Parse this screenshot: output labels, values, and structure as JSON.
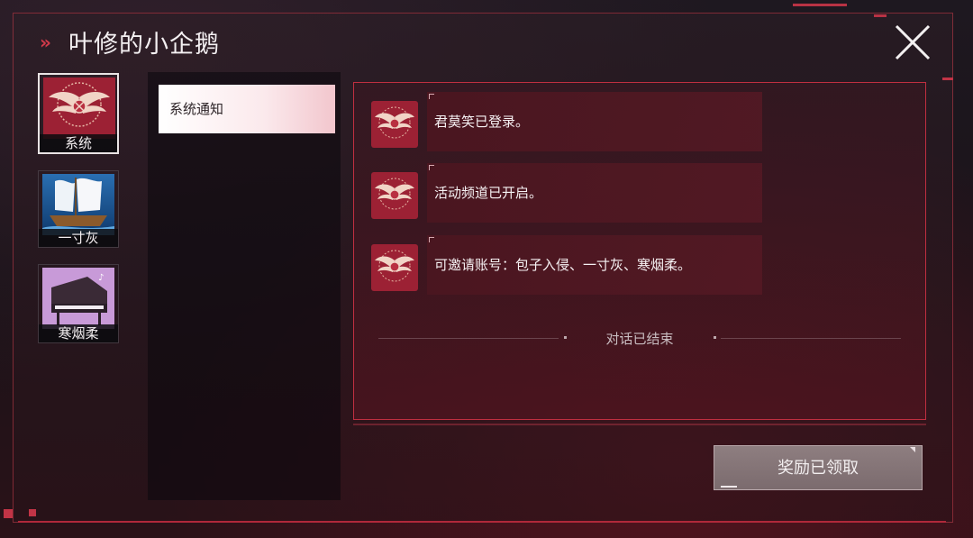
{
  "window": {
    "title": "叶修的小企鹅",
    "title_marker": "»"
  },
  "sidebar": {
    "contacts": [
      {
        "label": "系统",
        "icon": "system-wings-emblem-icon",
        "selected": true
      },
      {
        "label": "一寸灰",
        "icon": "sailing-ship-avatar-icon",
        "selected": false
      },
      {
        "label": "寒烟柔",
        "icon": "grand-piano-avatar-icon",
        "selected": false
      }
    ]
  },
  "sublist": {
    "items": [
      {
        "label": "系统通知",
        "selected": true
      }
    ]
  },
  "chat": {
    "messages": [
      {
        "sender": "系统",
        "avatar_icon": "system-wings-emblem-icon",
        "text": "君莫笑已登录。"
      },
      {
        "sender": "系统",
        "avatar_icon": "system-wings-emblem-icon",
        "text": "活动频道已开启。"
      },
      {
        "sender": "系统",
        "avatar_icon": "system-wings-emblem-icon",
        "text": "可邀请账号：包子入侵、一寸灰、寒烟柔。"
      }
    ],
    "end_text": "对话已结束"
  },
  "footer": {
    "reward_button_label": "奖励已领取",
    "reward_button_state": "disabled"
  },
  "colors": {
    "accent_red": "#c02f40",
    "selected_tab": "#fbe9ec",
    "reward_button": "#8e7e80"
  }
}
